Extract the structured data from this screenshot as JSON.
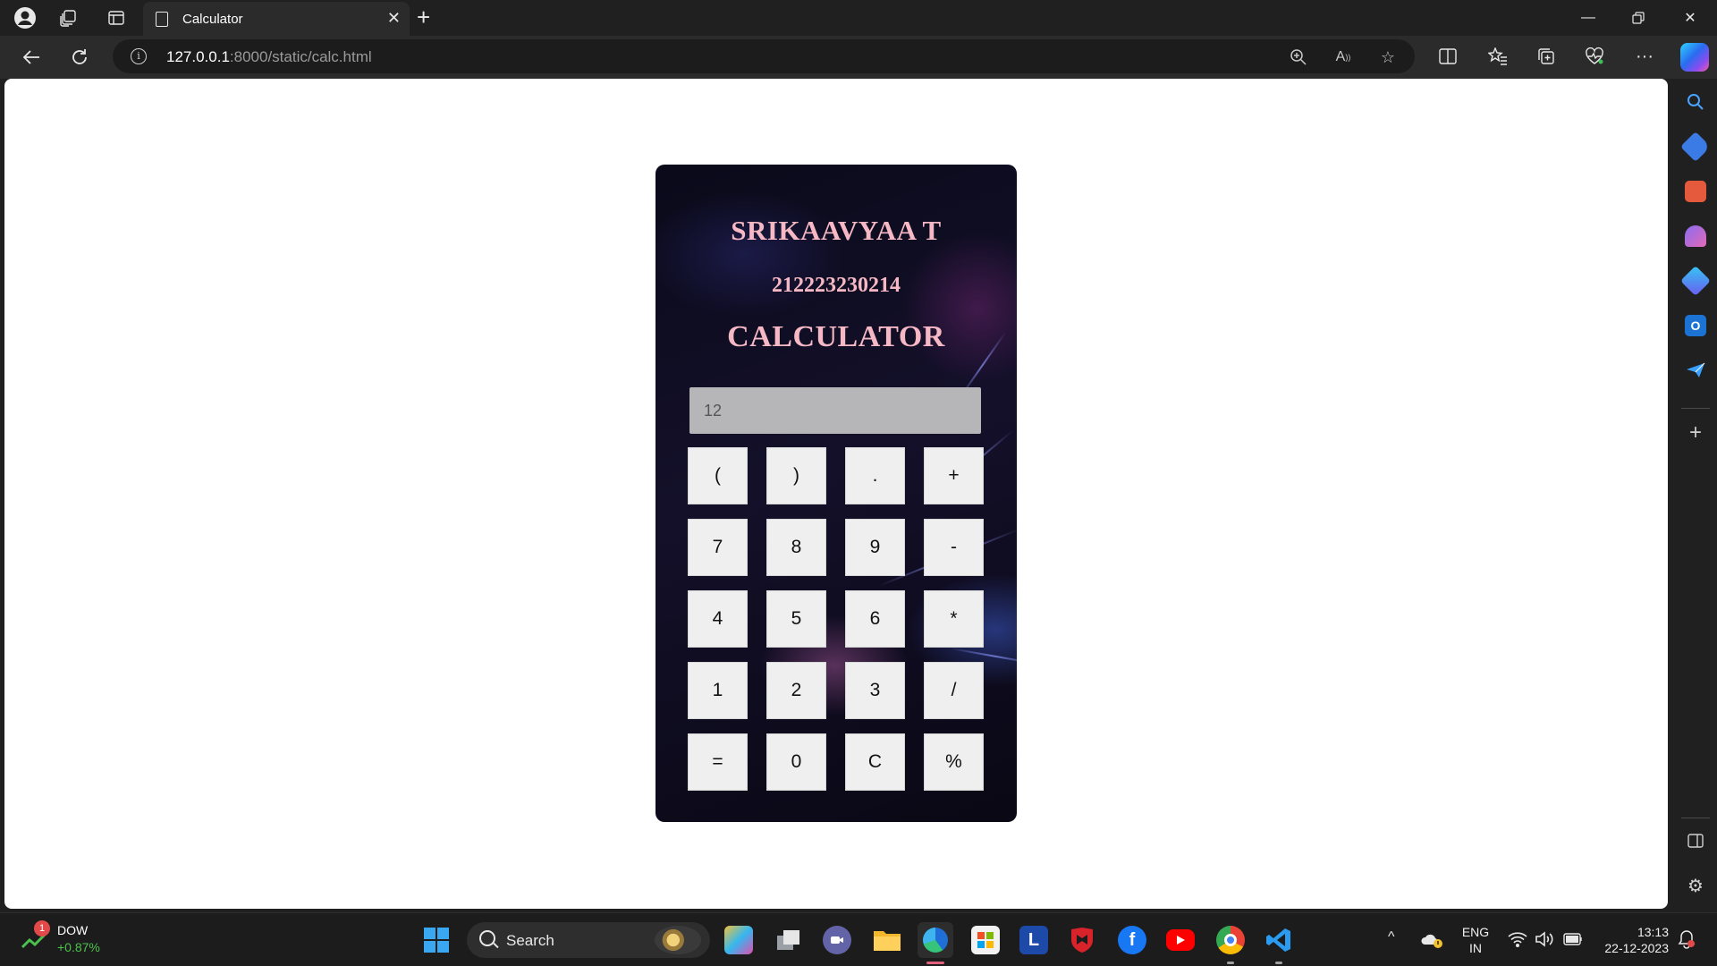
{
  "browser": {
    "tab": {
      "title": "Calculator"
    },
    "url": {
      "host": "127.0.0.1",
      "rest": ":8000/static/calc.html"
    }
  },
  "calculator": {
    "name": "SRIKAAVYAA T",
    "roll_number": "212223230214",
    "title": "CALCULATOR",
    "display_value": "12",
    "keys": [
      [
        "(",
        ")",
        ".",
        "+"
      ],
      [
        "7",
        "8",
        "9",
        "-"
      ],
      [
        "4",
        "5",
        "6",
        "*"
      ],
      [
        "1",
        "2",
        "3",
        "/"
      ],
      [
        "=",
        "0",
        "C",
        "%"
      ]
    ]
  },
  "taskbar": {
    "widget": {
      "badge": "1",
      "name": "DOW",
      "change": "+0.87%"
    },
    "search_label": "Search",
    "language": {
      "line1": "ENG",
      "line2": "IN"
    },
    "clock": {
      "time": "13:13",
      "date": "22-12-2023"
    },
    "colors": {
      "positive": "#4cc24c",
      "edge_blue": "#1f6fd6"
    }
  }
}
